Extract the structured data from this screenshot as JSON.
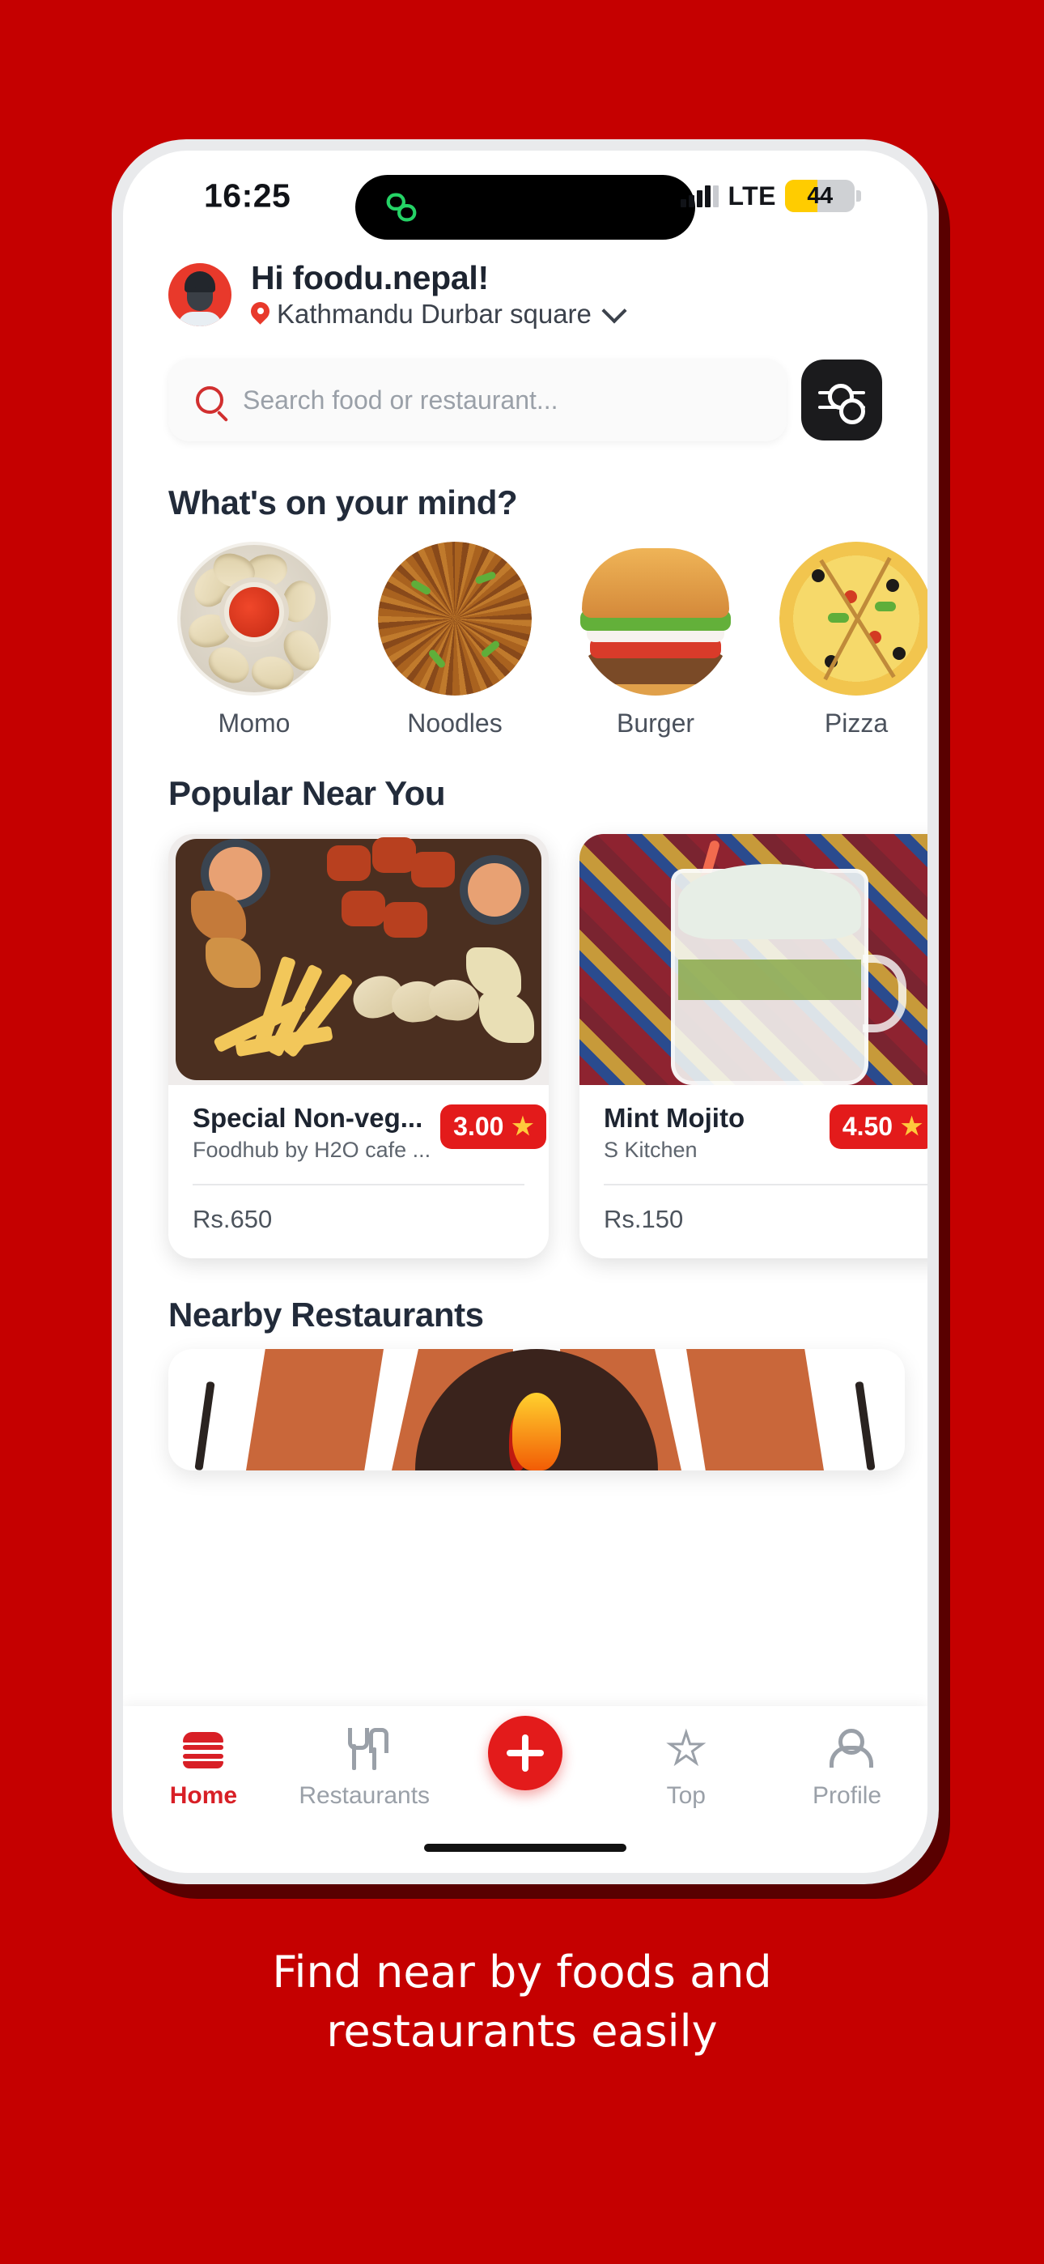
{
  "status_bar": {
    "time": "16:25",
    "network": "LTE",
    "battery_level": "44",
    "battery_color": "#FFCC00",
    "island_icon": "link-icon"
  },
  "header": {
    "greeting": "Hi foodu.nepal!",
    "location": "Kathmandu Durbar square",
    "location_icon": "map-pin-icon",
    "chevron_icon": "chevron-down-icon",
    "avatar_icon": "user-avatar"
  },
  "search": {
    "placeholder": "Search food or restaurant...",
    "search_icon": "search-icon",
    "filter_icon": "sliders-filter-icon"
  },
  "sections": {
    "mind_title": "What's on your mind?",
    "popular_title": "Popular Near You",
    "nearby_title": "Nearby Restaurants"
  },
  "categories": [
    {
      "label": "Momo",
      "icon": "momo-image"
    },
    {
      "label": "Noodles",
      "icon": "noodles-image"
    },
    {
      "label": "Burger",
      "icon": "burger-image"
    },
    {
      "label": "Pizza",
      "icon": "pizza-image"
    }
  ],
  "popular_items": [
    {
      "name": "Special Non-veg...",
      "restaurant": "Foodhub by H2O cafe ...",
      "rating": "3.00",
      "star_icon": "star-filled-icon",
      "price": "Rs.650",
      "image": "non-veg-platter-image"
    },
    {
      "name": "Mint Mojito",
      "restaurant": "S Kitchen",
      "rating": "4.50",
      "star_icon": "star-filled-icon",
      "price": "Rs.150",
      "image": "mint-mojito-image"
    }
  ],
  "bottom_nav": [
    {
      "label": "Home",
      "icon": "burger-home-icon",
      "active": true
    },
    {
      "label": "Restaurants",
      "icon": "fork-knife-icon",
      "active": false
    },
    {
      "label": "",
      "icon": "plus-add-icon",
      "active": false
    },
    {
      "label": "Top",
      "icon": "star-outline-icon",
      "active": false
    },
    {
      "label": "Profile",
      "icon": "person-outline-icon",
      "active": false
    }
  ],
  "caption": {
    "line1": "Find near by foods and",
    "line2": "restaurants easily"
  },
  "colors": {
    "background": "#C50000",
    "accent": "#E31B1B",
    "rating_badge": "#E31B1B",
    "heading": "#222b3a",
    "muted": "#9aa0a8"
  }
}
